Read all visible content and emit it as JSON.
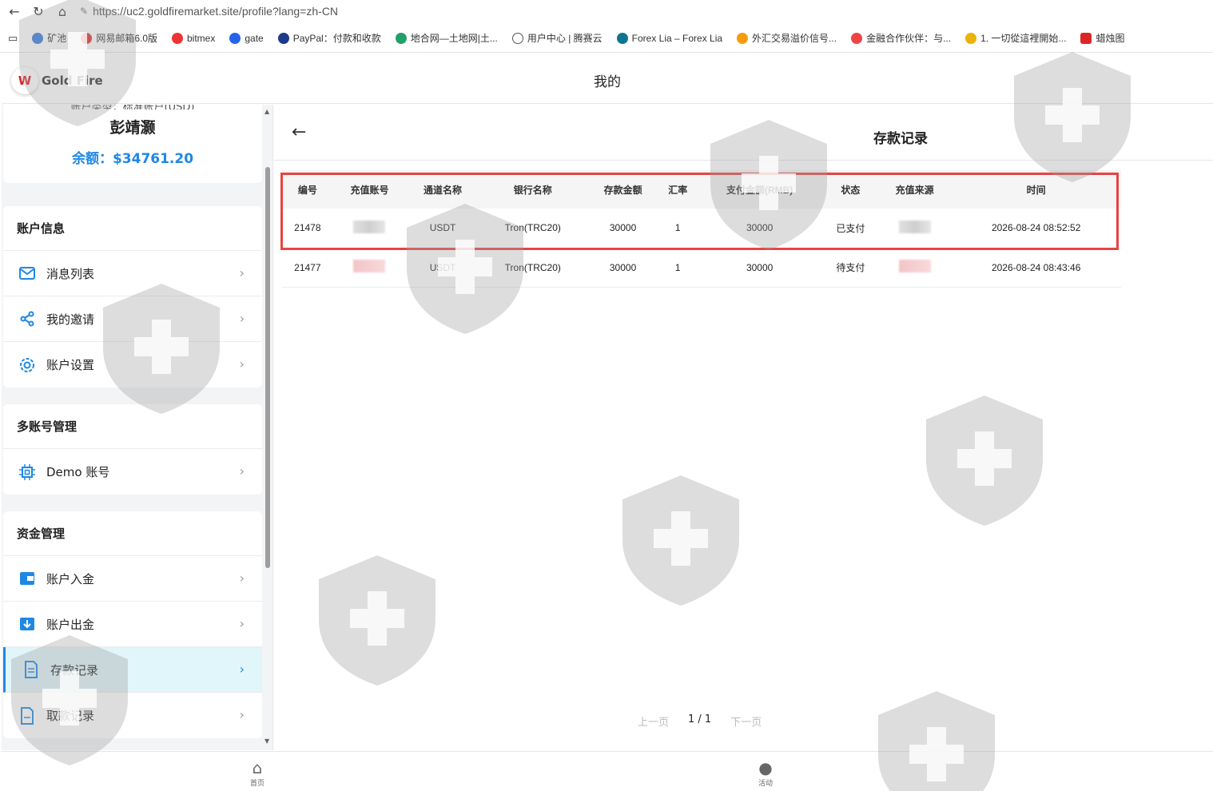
{
  "browser": {
    "url": "https://uc2.goldfiremarket.site/profile?lang=zh-CN",
    "bookmarks": [
      {
        "label": "矿池",
        "color": "#3b7ddd"
      },
      {
        "label": "网易邮箱6.0版",
        "color": "#d33"
      },
      {
        "label": "bitmex",
        "color": "#e33"
      },
      {
        "label": "gate",
        "color": "#2563eb"
      },
      {
        "label": "PayPal：付款和收款",
        "color": "#1e3a8a"
      },
      {
        "label": "地合网—土地网|土...",
        "color": "#22a06b"
      },
      {
        "label": "用户中心 | 腾赛云",
        "color": "#555"
      },
      {
        "label": "Forex Lia – Forex Lia",
        "color": "#0e7490"
      },
      {
        "label": "外汇交易溢价信号...",
        "color": "#f59e0b"
      },
      {
        "label": "金融合作伙伴：与...",
        "color": "#ef4444"
      },
      {
        "label": "1. 一切從這裡開始...",
        "color": "#eab308"
      },
      {
        "label": "蜡烛图",
        "color": "#dc2626"
      }
    ]
  },
  "app": {
    "logo_text": "Gold Fire",
    "logo_mark": "W",
    "page_title": "我的"
  },
  "profile": {
    "account_type": "账户类型：标准账户(USD)",
    "name": "彭靖灏",
    "balance": "余额：$34761.20"
  },
  "sidebar": {
    "groups": [
      {
        "title": "账户信息",
        "items": [
          "消息列表",
          "我的邀请",
          "账户设置"
        ]
      },
      {
        "title": "多账号管理",
        "items": [
          "Demo 账号"
        ]
      },
      {
        "title": "资金管理",
        "items": [
          "账户入金",
          "账户出金",
          "存款记录",
          "取款记录"
        ]
      }
    ],
    "active_item": "存款记录"
  },
  "deposit_records": {
    "title": "存款记录",
    "columns": [
      "编号",
      "充值账号",
      "通道名称",
      "银行名称",
      "存款金额",
      "汇率",
      "支付金额(RMB)",
      "状态",
      "充值来源",
      "时间"
    ],
    "rows": [
      {
        "id": "21478",
        "account": "",
        "channel": "USDT",
        "bank": "Tron(TRC20)",
        "amount": "30000",
        "rate": "1",
        "pay_rmb": "30000",
        "status": "已支付",
        "source": "",
        "time": "2026-08-24 08:52:52"
      },
      {
        "id": "21477",
        "account": "",
        "channel": "USDT",
        "bank": "Tron(TRC20)",
        "amount": "30000",
        "rate": "1",
        "pay_rmb": "30000",
        "status": "待支付",
        "source": "",
        "time": "2026-08-24 08:43:46"
      }
    ]
  },
  "pagination": {
    "prev": "上一页",
    "current": "1 / 1",
    "next": "下一页"
  },
  "tabbar": {
    "home": "首页",
    "activity": "活动"
  }
}
